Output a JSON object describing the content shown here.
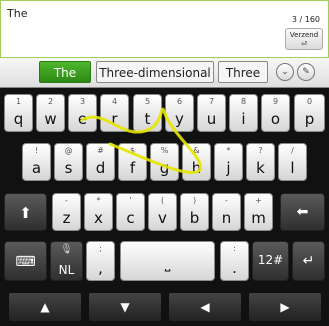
{
  "compose": {
    "text": "The",
    "counter": "3 / 160",
    "send_label": "Verzend"
  },
  "suggestions": {
    "primary": "The",
    "alt1": "Three-dimensional",
    "alt2": "Three",
    "expand_icon": "chevron-down-icon",
    "pen_icon": "pen-icon"
  },
  "rows": [
    [
      {
        "h": "1",
        "k": "q"
      },
      {
        "h": "2",
        "k": "w"
      },
      {
        "h": "3",
        "k": "e"
      },
      {
        "h": "4",
        "k": "r"
      },
      {
        "h": "5",
        "k": "t"
      },
      {
        "h": "6",
        "k": "y"
      },
      {
        "h": "7",
        "k": "u"
      },
      {
        "h": "8",
        "k": "i"
      },
      {
        "h": "9",
        "k": "o"
      },
      {
        "h": "0",
        "k": "p"
      }
    ],
    [
      {
        "h": "!",
        "k": "a"
      },
      {
        "h": "@",
        "k": "s"
      },
      {
        "h": "#",
        "k": "d"
      },
      {
        "h": "$",
        "k": "f"
      },
      {
        "h": "%",
        "k": "g"
      },
      {
        "h": "&",
        "k": "h"
      },
      {
        "h": "*",
        "k": "j"
      },
      {
        "h": "?",
        "k": "k"
      },
      {
        "h": "/",
        "k": "l"
      }
    ],
    [
      {
        "h": "-",
        "k": "z"
      },
      {
        "h": "*",
        "k": "x"
      },
      {
        "h": "'",
        "k": "c"
      },
      {
        "h": "(",
        "k": "v"
      },
      {
        "h": ")",
        "k": "b"
      },
      {
        "h": "-",
        "k": "n"
      },
      {
        "h": "+",
        "k": "m"
      }
    ]
  ],
  "special": {
    "shift_icon": "up-arrow-icon",
    "backspace_icon": "left-arrow-icon",
    "keyboard_icon": "keyboard-icon",
    "mic_icon": "mic-icon",
    "lang": "NL",
    "comma": ",",
    "comma_hint": ";",
    "period": ".",
    "period_hint": ":",
    "symbols": "12#",
    "enter_icon": "enter-icon"
  },
  "arrows": {
    "up": "▲",
    "down": "▼",
    "left": "◀",
    "right": "▶"
  },
  "colors": {
    "accent": "#2c8a14",
    "trail": "#e6e600"
  }
}
